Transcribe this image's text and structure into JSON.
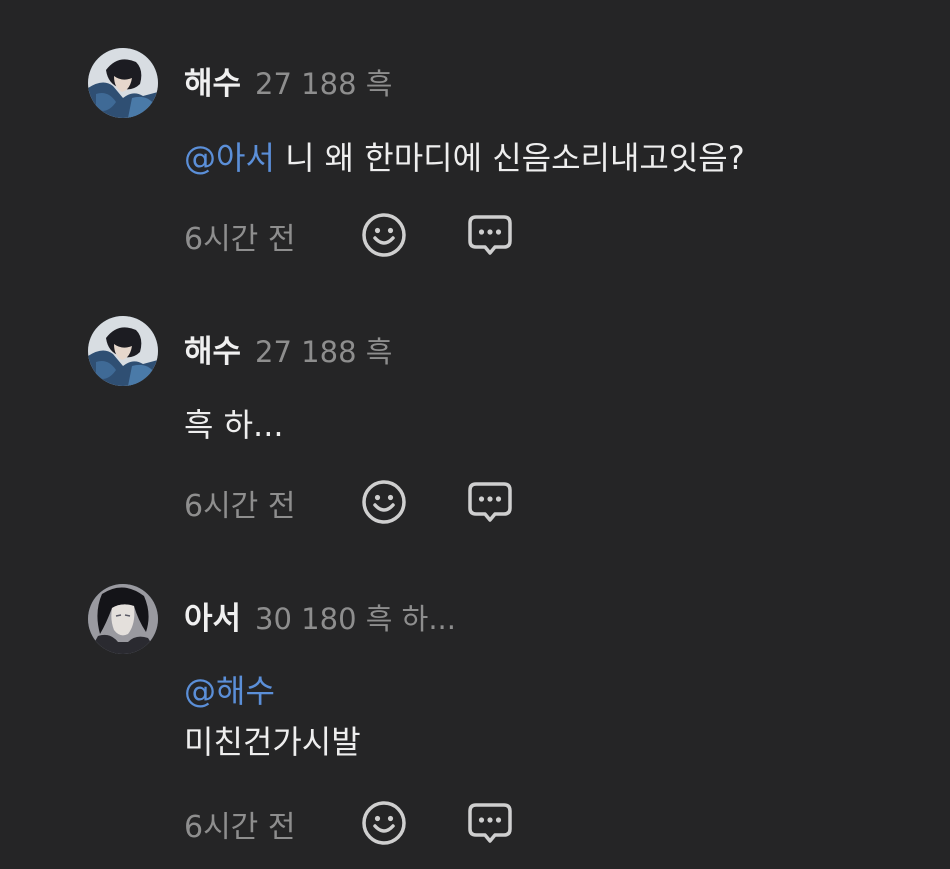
{
  "comments": [
    {
      "username": "해수",
      "meta": "27 188 흑",
      "mention": "@아서",
      "text": " 니 왜 한마디에 신음소리내고잇음?",
      "time": "6시간 전",
      "icons": [
        "smiley-icon",
        "chat-bubble-icon"
      ]
    },
    {
      "username": "해수",
      "meta": "27 188 흑",
      "text": "흑 하...",
      "time": "6시간 전",
      "icons": [
        "smiley-icon",
        "chat-bubble-icon"
      ]
    },
    {
      "username": "아서",
      "meta": "30 180 흑 하...",
      "mention": "@해수",
      "text": "미친건가시발",
      "time": "6시간 전",
      "icons": [
        "smiley-icon",
        "chat-bubble-icon"
      ]
    }
  ],
  "colors": {
    "background": "#252526",
    "mention": "#5b8fd8",
    "meta": "#8e8e8e",
    "text": "#eeeeee"
  }
}
